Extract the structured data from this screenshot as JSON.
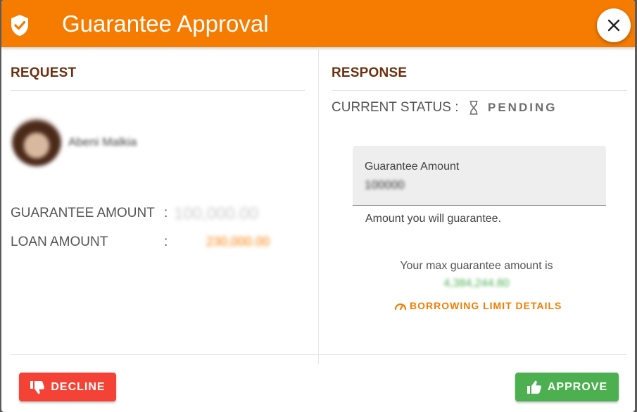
{
  "header": {
    "title": "Guarantee Approval",
    "icon": "shield-check-icon",
    "color": "#f57c00"
  },
  "request": {
    "section_title": "REQUEST",
    "requester_name": "Abeni Malkia",
    "guarantee_amount_label": "GUARANTEE AMOUNT",
    "guarantee_amount_value": "100,000.00",
    "loan_amount_label": "LOAN AMOUNT",
    "loan_amount_value": "230,000.00",
    "separator": ":"
  },
  "response": {
    "section_title": "RESPONSE",
    "status_label": "CURRENT STATUS :",
    "status_value": "PENDING",
    "status_icon": "hourglass-icon",
    "field_label": "Guarantee Amount",
    "field_value": "100000",
    "field_helper": "Amount you will guarantee.",
    "max_label": "Your max guarantee amount is",
    "max_value": "4,384,244.80",
    "borrow_link": "BORROWING LIMIT DETAILS"
  },
  "actions": {
    "decline": "DECLINE",
    "approve": "APPROVE"
  },
  "colors": {
    "accent": "#f57c00",
    "decline": "#f44336",
    "approve": "#4caf50",
    "section_title": "#6d2f10",
    "loan_value": "#f57c00",
    "guarantee_value": "#cccccc"
  }
}
